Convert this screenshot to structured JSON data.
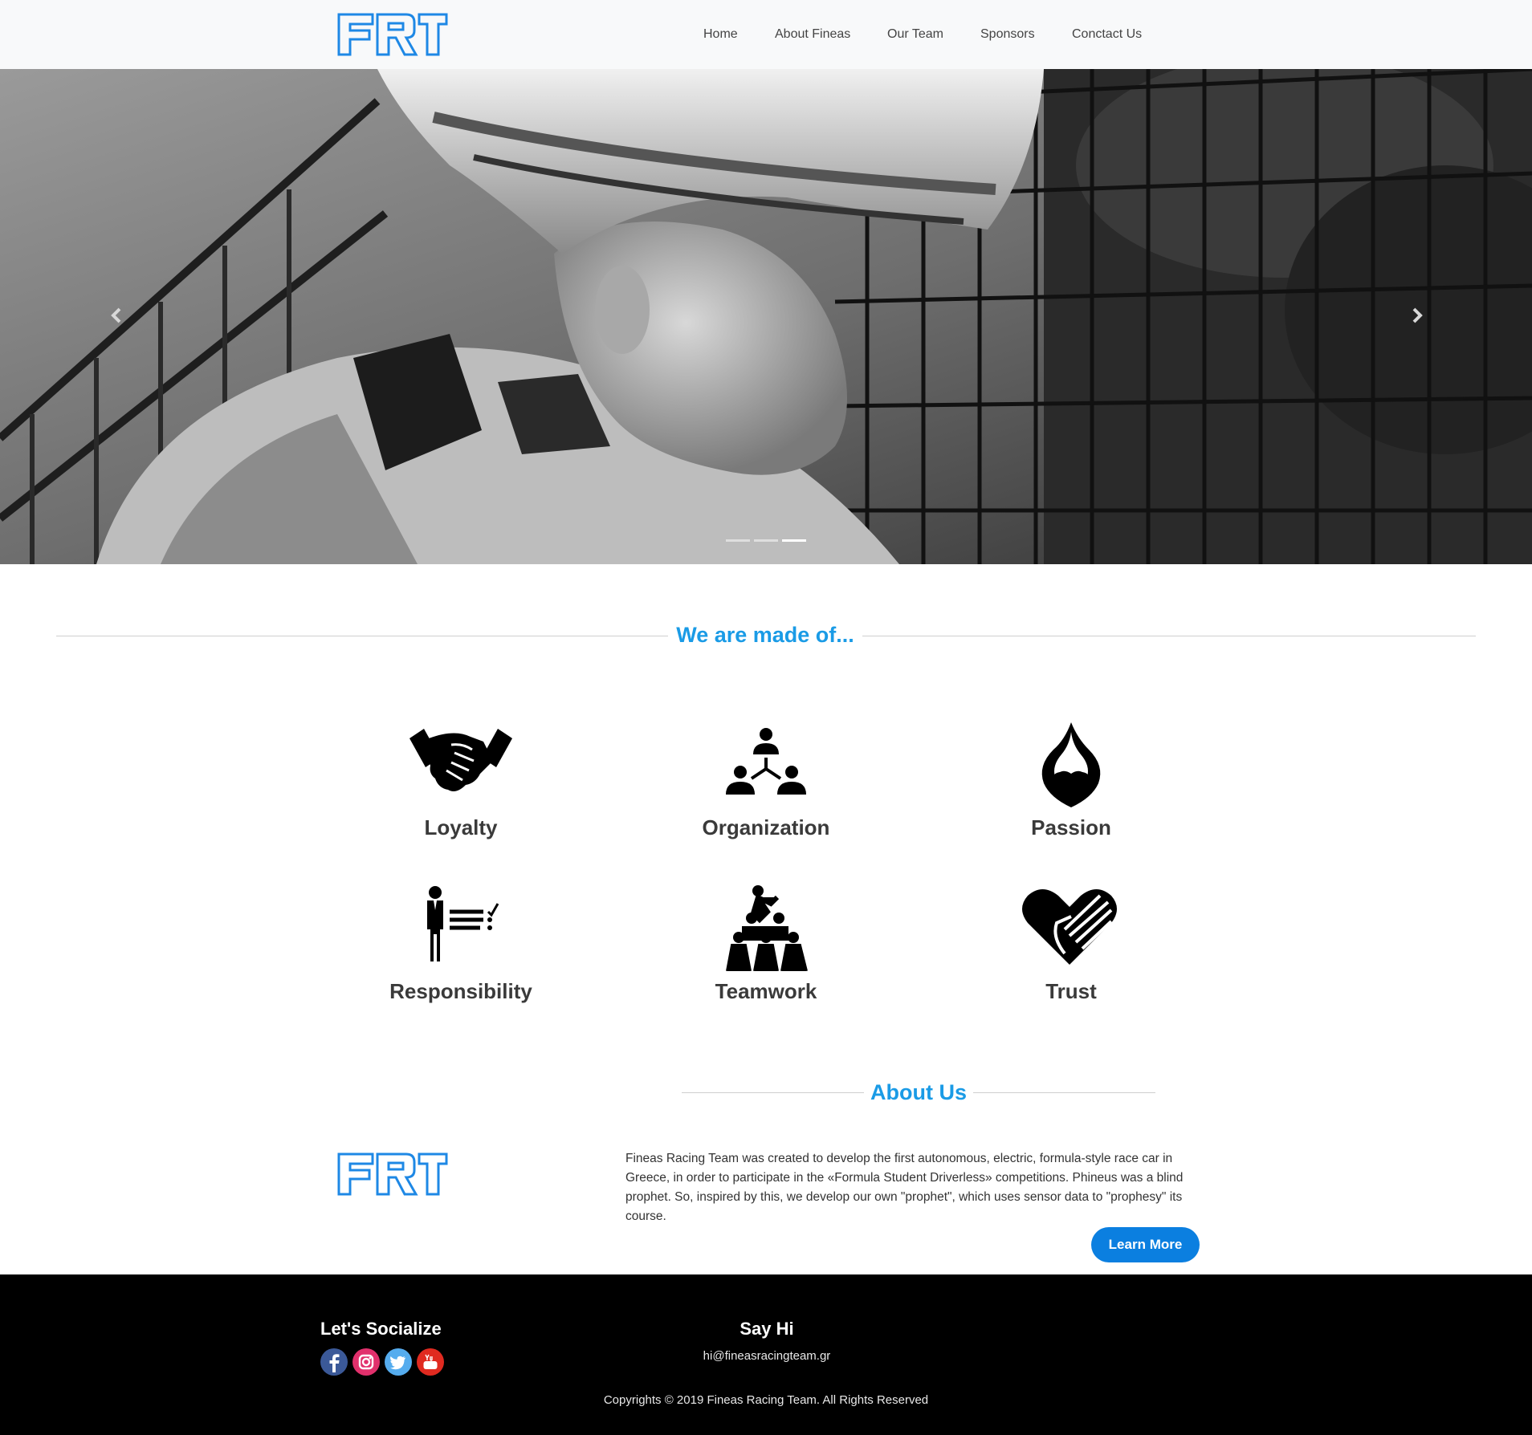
{
  "colors": {
    "accent": "#1a9be6",
    "logo_blue": "#1e88e5",
    "button_blue": "#0b7fe0",
    "navbar_bg": "#f8f9fa",
    "footer_bg": "#000000",
    "facebook": "#3b5998",
    "instagram": "#e1306c",
    "twitter": "#55acee",
    "youtube": "#e02a20"
  },
  "nav": {
    "logo_icon": "frt-logo",
    "items": [
      {
        "label": "Home"
      },
      {
        "label": "About Fineas"
      },
      {
        "label": "Our Team"
      },
      {
        "label": "Sponsors"
      },
      {
        "label": "Conctact Us"
      }
    ]
  },
  "hero": {
    "image": "black-and-white photo of helmeted racing driver leaning on a mesh fence",
    "prev_icon": "chevron-left-icon",
    "next_icon": "chevron-right-icon",
    "slides_total": 3,
    "active_slide": 3
  },
  "values_section": {
    "title": "We are made of...",
    "items": [
      {
        "label": "Loyalty",
        "icon": "handshake-icon"
      },
      {
        "label": "Organization",
        "icon": "org-chart-icon"
      },
      {
        "label": "Passion",
        "icon": "flaming-heart-icon"
      },
      {
        "label": "Responsibility",
        "icon": "person-checklist-icon"
      },
      {
        "label": "Teamwork",
        "icon": "human-pyramid-icon"
      },
      {
        "label": "Trust",
        "icon": "heart-hand-icon"
      }
    ]
  },
  "about": {
    "title": "About Us",
    "text": "Fineas Racing Team was created to develop the first autonomous, electric, formula-style race car in Greece, in order to participate in the «Formula Student Driverless» competitions. Phineus was a blind prophet. So, inspired by this, we develop our own \"prophet\", which uses sensor data to \"prophesy\" its course.",
    "button_label": "Learn More"
  },
  "footer": {
    "socialize_title": "Let's Socialize",
    "social_icons": [
      "facebook-icon",
      "instagram-icon",
      "twitter-icon",
      "youtube-icon"
    ],
    "say_hi_title": "Say Hi",
    "email": "hi@fineasracingteam.gr",
    "copyright": "Copyrights © 2019 Fineas Racing Team. All Rights Reserved"
  }
}
